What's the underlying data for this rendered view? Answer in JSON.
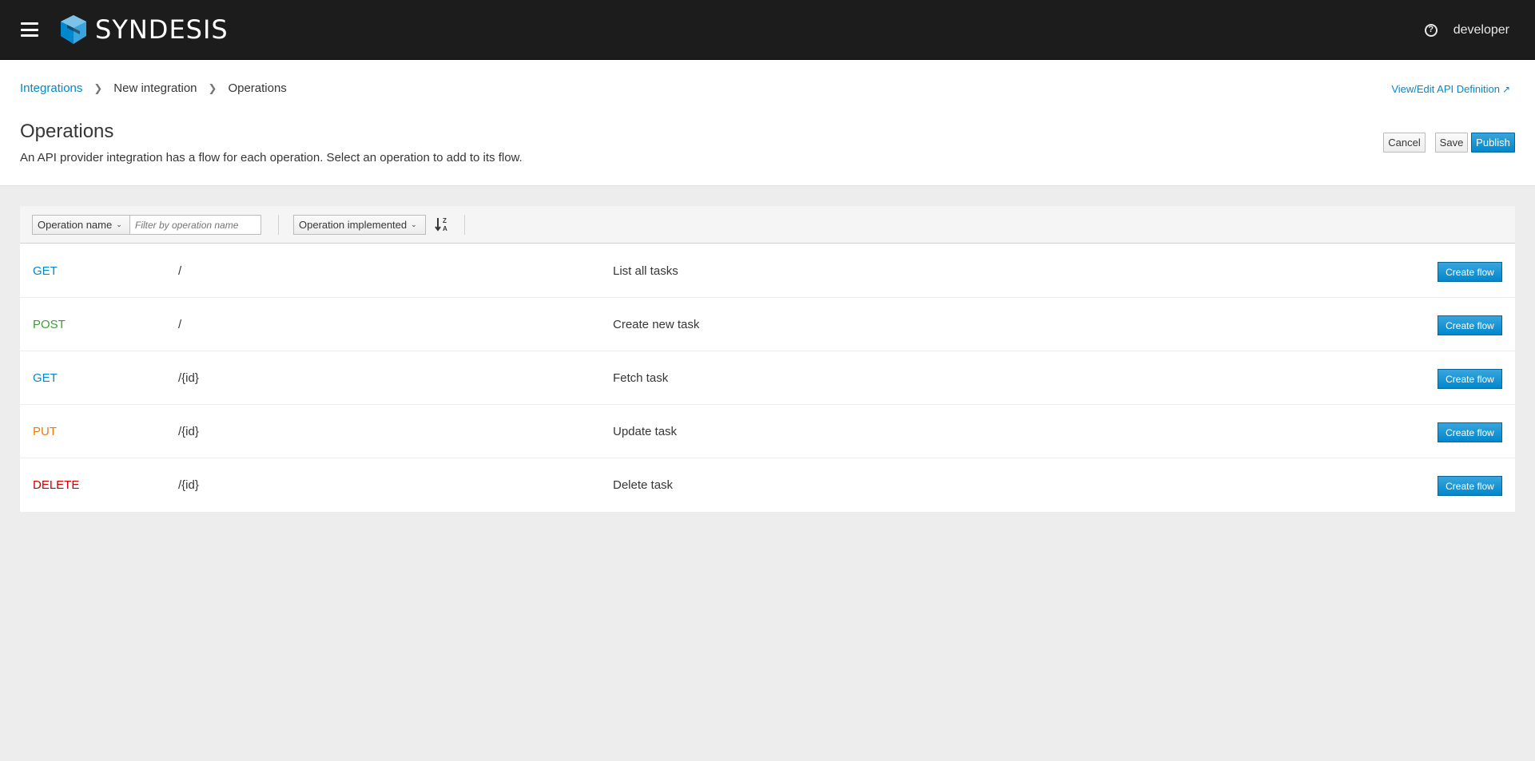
{
  "navbar": {
    "brand": "SYNDESIS",
    "user": "developer"
  },
  "breadcrumb": {
    "items": [
      "Integrations",
      "New integration",
      "Operations"
    ]
  },
  "header": {
    "api_link": "View/Edit API Definition",
    "title": "Operations",
    "description": "An API provider integration has a flow for each operation. Select an operation to add to its flow.",
    "cancel_label": "Cancel",
    "save_label": "Save",
    "publish_label": "Publish"
  },
  "toolbar": {
    "filter_field": "Operation name",
    "filter_placeholder": "Filter by operation name",
    "sort_field": "Operation implemented"
  },
  "colors": {
    "get": "#0088ce",
    "post": "#3f9c35",
    "put": "#ec7a08",
    "delete": "#cc0000",
    "primary": "#0088ce"
  },
  "operations": [
    {
      "method": "GET",
      "path": "/",
      "description": "List all tasks",
      "action": "Create flow"
    },
    {
      "method": "POST",
      "path": "/",
      "description": "Create new task",
      "action": "Create flow"
    },
    {
      "method": "GET",
      "path": "/{id}",
      "description": "Fetch task",
      "action": "Create flow"
    },
    {
      "method": "PUT",
      "path": "/{id}",
      "description": "Update task",
      "action": "Create flow"
    },
    {
      "method": "DELETE",
      "path": "/{id}",
      "description": "Delete task",
      "action": "Create flow"
    }
  ]
}
